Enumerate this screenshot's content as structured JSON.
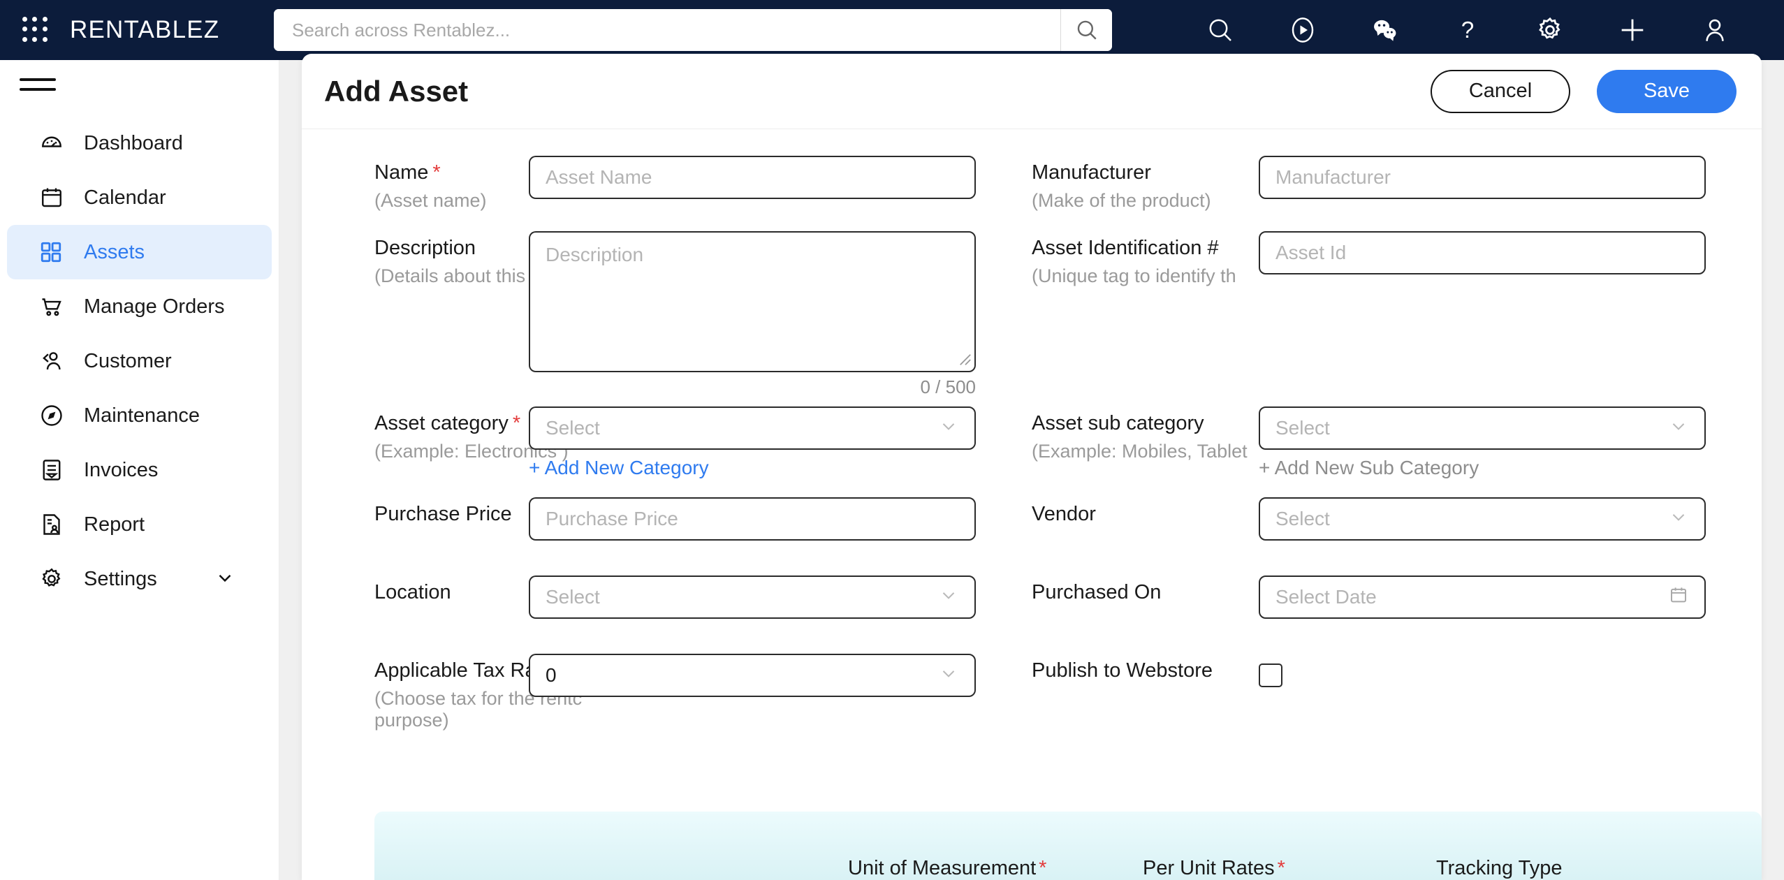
{
  "topbar": {
    "apps_icon": "grid-apps-icon",
    "brand": "RENTABLEZ",
    "search": {
      "placeholder": "Search across Rentablez...",
      "value": "",
      "button_icon": "search-icon"
    },
    "icons": [
      {
        "name": "search-icon",
        "label": "Search"
      },
      {
        "name": "play-circle-icon",
        "label": "Tutorials"
      },
      {
        "name": "chat-bubbles-icon",
        "label": "Chat"
      },
      {
        "name": "question-mark-icon",
        "label": "Help"
      },
      {
        "name": "gear-icon",
        "label": "Settings"
      },
      {
        "name": "plus-icon",
        "label": "Add",
        "active": true
      },
      {
        "name": "user-avatar-icon",
        "label": "Profile"
      }
    ],
    "accent": "#2f7bef",
    "background": "#0c1c3b"
  },
  "sidebar": {
    "menu_icon": "hamburger-icon",
    "items": [
      {
        "label": "Dashboard",
        "icon": "speedometer-icon",
        "active": false
      },
      {
        "label": "Calendar",
        "icon": "calendar-icon",
        "active": false
      },
      {
        "label": "Assets",
        "icon": "grid-squares-icon",
        "active": true
      },
      {
        "label": "Manage Orders",
        "icon": "shopping-cart-icon",
        "active": false
      },
      {
        "label": "Customer",
        "icon": "people-icon",
        "active": false
      },
      {
        "label": "Maintenance",
        "icon": "compass-icon",
        "active": false
      },
      {
        "label": "Invoices",
        "icon": "invoice-document-icon",
        "active": false
      },
      {
        "label": "Report",
        "icon": "report-document-icon",
        "active": false
      },
      {
        "label": "Settings",
        "icon": "gear-icon",
        "active": false,
        "expandable": true
      }
    ],
    "active_bg": "#e4effd",
    "active_color": "#2f7bef"
  },
  "header": {
    "title": "Add Asset",
    "cancel_label": "Cancel",
    "save_label": "Save"
  },
  "form": {
    "name": {
      "label": "Name",
      "required": "*",
      "hint": "(Asset name)",
      "placeholder": "Asset Name",
      "value": ""
    },
    "manufacturer": {
      "label": "Manufacturer",
      "hint": "(Make of the product)",
      "placeholder": "Manufacturer",
      "value": ""
    },
    "description": {
      "label": "Description",
      "hint": "(Details about this asset)",
      "placeholder": "Description",
      "value": "",
      "counter": "0 / 500"
    },
    "asset_id": {
      "label": "Asset Identification #",
      "hint": "(Unique tag to identify th",
      "placeholder": "Asset Id",
      "value": ""
    },
    "asset_category": {
      "label": "Asset category",
      "required": "*",
      "hint": "(Example: Electronics )",
      "placeholder": "Select",
      "value": "",
      "add_link": "+ Add New Category"
    },
    "asset_sub_category": {
      "label": "Asset sub category",
      "hint": "(Example: Mobiles, Tablet",
      "placeholder": "Select",
      "value": "",
      "add_link": "+ Add New Sub Category"
    },
    "purchase_price": {
      "label": "Purchase Price",
      "placeholder": "Purchase Price",
      "value": ""
    },
    "vendor": {
      "label": "Vendor",
      "placeholder": "Select",
      "value": ""
    },
    "location": {
      "label": "Location",
      "placeholder": "Select",
      "value": ""
    },
    "purchased_on": {
      "label": "Purchased On",
      "placeholder": "Select Date",
      "value": ""
    },
    "tax_rates": {
      "label": "Applicable Tax Rates",
      "hint": "(Choose tax for the rentc purpose)",
      "value": "0"
    },
    "publish_webstore": {
      "label": "Publish to Webstore",
      "checked": false
    }
  },
  "rates_panel": {
    "columns": [
      {
        "label": "Unit of Measurement",
        "required": "*"
      },
      {
        "label": "Per Unit Rates",
        "required": "*"
      },
      {
        "label": "Tracking Type",
        "required": ""
      }
    ],
    "background_top": "#ecfbfd",
    "background_bottom": "#d9f2f5"
  }
}
